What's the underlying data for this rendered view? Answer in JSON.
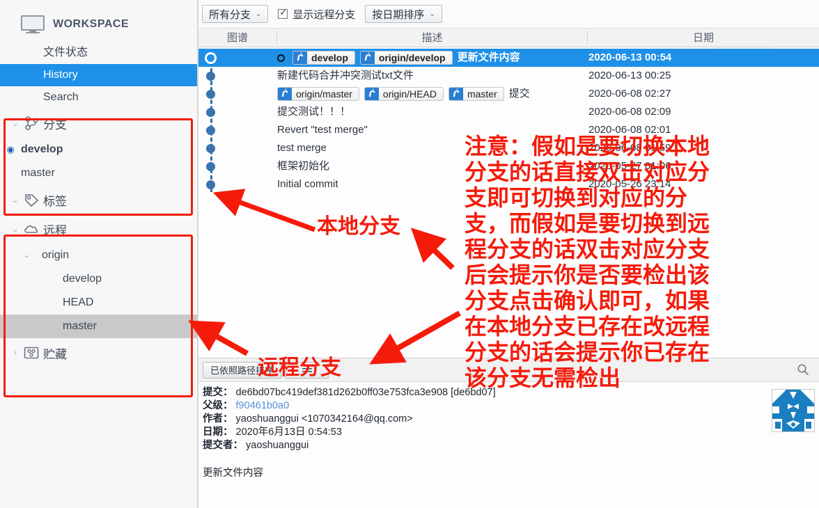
{
  "sidebar": {
    "workspace_label": "WORKSPACE",
    "workspace_icon": "monitor-icon",
    "nav": [
      {
        "label": "文件状态",
        "selected": false
      },
      {
        "label": "History",
        "selected": true
      },
      {
        "label": "Search",
        "selected": false
      }
    ],
    "groups": [
      {
        "label": "分支",
        "icon": "branch-icon",
        "expanded": true,
        "items": [
          {
            "label": "develop",
            "bold": true,
            "bullet": "current-branch-dot",
            "highlighted": false
          },
          {
            "label": "master",
            "bold": false,
            "bullet": "",
            "highlighted": false
          }
        ]
      },
      {
        "label": "标签",
        "icon": "tag-icon",
        "expanded": false,
        "items": []
      },
      {
        "label": "远程",
        "icon": "cloud-icon",
        "expanded": true,
        "items": [
          {
            "label": "origin",
            "bold": false,
            "bullet": "",
            "highlighted": false,
            "sub": true
          },
          {
            "label": "develop",
            "bold": false,
            "bullet": "",
            "highlighted": false
          },
          {
            "label": "HEAD",
            "bold": false,
            "bullet": "",
            "highlighted": false
          },
          {
            "label": "master",
            "bold": false,
            "bullet": "",
            "highlighted": true
          }
        ]
      },
      {
        "label": "贮藏",
        "icon": "stash-icon",
        "expanded": false,
        "items": []
      }
    ]
  },
  "toolbar": {
    "branch_filter": "所有分支",
    "show_remote_label": "显示远程分支",
    "show_remote_checked": true,
    "sort_mode": "按日期排序"
  },
  "table": {
    "headers": {
      "graph": "图谱",
      "description": "描述",
      "date": "日期"
    },
    "rows": [
      {
        "selected": true,
        "head": true,
        "badges": [
          {
            "text": "develop"
          },
          {
            "text": "origin/develop"
          }
        ],
        "description": "更新文件内容",
        "truncated": "",
        "date": "2020-06-13 00:54"
      },
      {
        "selected": false,
        "head": false,
        "badges": [],
        "description": "新建代码合并冲突测试txt文件",
        "truncated": "",
        "date": "2020-06-13 00:25"
      },
      {
        "selected": false,
        "head": false,
        "badges": [
          {
            "text": "origin/master"
          },
          {
            "text": "origin/HEAD"
          },
          {
            "text": "master"
          }
        ],
        "description": "",
        "truncated": "提交",
        "date": "2020-06-08 02:27"
      },
      {
        "selected": false,
        "head": false,
        "badges": [],
        "description": "提交测试！！！",
        "truncated": "",
        "date": "2020-06-08 02:09"
      },
      {
        "selected": false,
        "head": false,
        "badges": [],
        "description": "Revert \"test merge\"",
        "truncated": "",
        "date": "2020-06-08 02:01"
      },
      {
        "selected": false,
        "head": false,
        "badges": [],
        "description": "test merge",
        "truncated": "",
        "date": "2020-06-08 01:59"
      },
      {
        "selected": false,
        "head": false,
        "badges": [],
        "description": "框架初始化",
        "truncated": "",
        "date": "2020-05-27 01:06"
      },
      {
        "selected": false,
        "head": false,
        "badges": [],
        "description": "Initial commit",
        "truncated": "",
        "date": "2020-05-26 23:14"
      }
    ]
  },
  "details": {
    "sort_button": "已依照路径排序",
    "view_button": "",
    "search_icon": "search-icon",
    "labels": {
      "commit": "提交：",
      "parent": "父级：",
      "author": "作者：",
      "date": "日期：",
      "committer": "提交者："
    },
    "commit_hash": "de6bd07bc419def381d262b0ff03e753fca3e908 [de6bd07]",
    "parent_hash": "f90461b0a0",
    "author": "yaoshuanggui <1070342164@qq.com>",
    "date": "2020年6月13日 0:54:53",
    "committer": "yaoshuanggui",
    "message": "更新文件内容"
  },
  "annotations": {
    "local_branch": "本地分支",
    "remote_branch": "远程分支",
    "note_lines": [
      "注意：假如是要切换本地",
      "分支的话直接双击对应分",
      "支即可切换到对应的分",
      "支，而假如是要切换到远",
      "程分支的话双击对应分支",
      "后会提示你是否要检出该",
      "分支点击确认即可，如果",
      "在本地分支已存在改远程",
      "分支的话会提示你已存在",
      "该分支无需检出"
    ]
  },
  "colors": {
    "accent": "#1e90e8",
    "annotation_red": "#f51b0b",
    "badge_blue": "#2a7fd4",
    "sidebar_bg": "#f7f7f7"
  }
}
